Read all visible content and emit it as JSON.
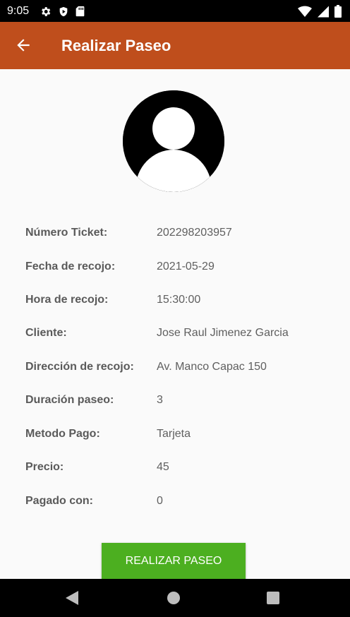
{
  "status_bar": {
    "time": "9:05",
    "left_icons": [
      "gear-icon",
      "shield-play-icon",
      "sd-card-icon"
    ],
    "right_icons": [
      "wifi-icon",
      "signal-icon",
      "battery-icon"
    ]
  },
  "app_bar": {
    "title": "Realizar Paseo",
    "background": "#bf4e1c",
    "back_icon": "arrow-back-icon"
  },
  "avatar": {
    "icon": "default-user-avatar-icon"
  },
  "details": [
    {
      "label": "Número Ticket:",
      "value": "202298203957"
    },
    {
      "label": "Fecha de recojo:",
      "value": "2021-05-29"
    },
    {
      "label": "Hora de recojo:",
      "value": "15:30:00"
    },
    {
      "label": "Cliente:",
      "value": "Jose Raul Jimenez Garcia"
    },
    {
      "label": "Dirección de recojo:",
      "value": "Av. Manco Capac 150"
    },
    {
      "label": "Duración paseo:",
      "value": "3"
    },
    {
      "label": "Metodo Pago:",
      "value": "Tarjeta"
    },
    {
      "label": "Precio:",
      "value": "45"
    },
    {
      "label": "Pagado con:",
      "value": "0"
    }
  ],
  "action_button": {
    "label": "REALIZAR PASEO",
    "color": "#4caf20"
  },
  "nav_bar": {
    "icons": [
      "nav-back-icon",
      "nav-home-icon",
      "nav-recents-icon"
    ]
  }
}
